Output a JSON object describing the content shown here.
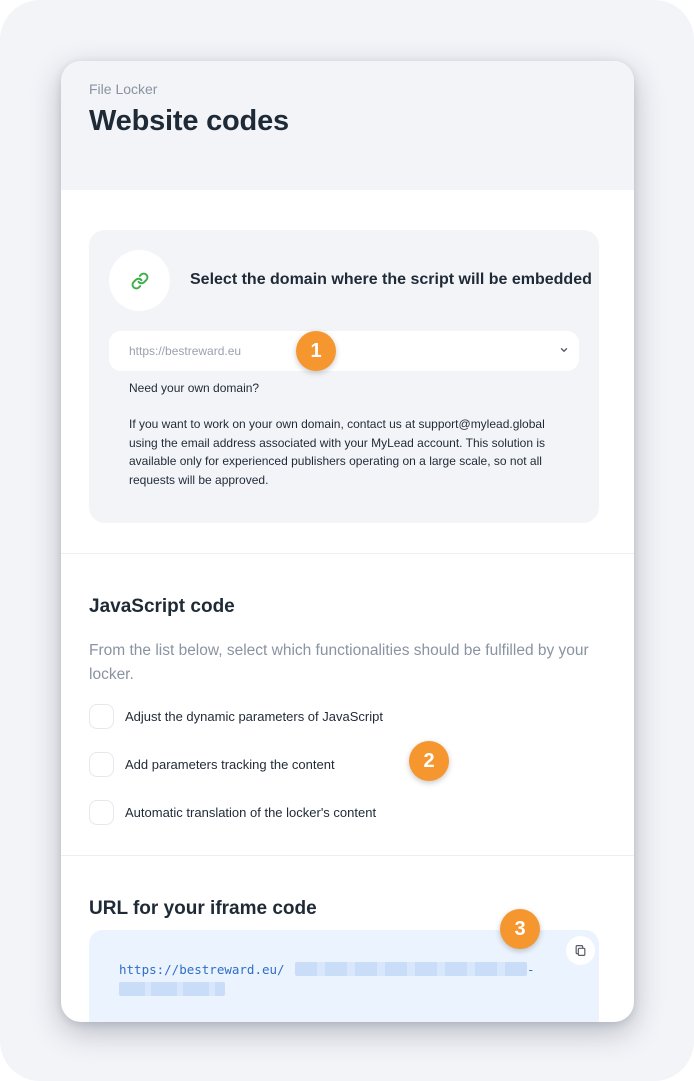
{
  "header": {
    "breadcrumb": "File Locker",
    "title": "Website codes"
  },
  "domain": {
    "icon": "link-icon",
    "heading": "Select the domain where the script will be embedded",
    "selected_value": "https://bestreward.eu",
    "need_own_domain": "Need your own domain?",
    "note": "If you want to work on your own domain, contact us at support@mylead.global using the email address associated with your MyLead account. This solution is available only for experienced publishers operating on a large scale, so not all requests will be approved."
  },
  "javascript": {
    "title": "JavaScript code",
    "description": "From the list below, select which functionalities should be fulfilled by your locker.",
    "options": [
      {
        "label": "Adjust the dynamic parameters of JavaScript",
        "checked": false
      },
      {
        "label": "Add parameters tracking the content",
        "checked": false
      },
      {
        "label": "Automatic translation of the locker's content",
        "checked": false
      }
    ]
  },
  "iframe": {
    "title": "URL for your iframe code",
    "url_prefix": "https://bestreward.eu/",
    "url_suffix": "-",
    "copy_icon": "copy-icon"
  },
  "markers": [
    "1",
    "2",
    "3"
  ],
  "colors": {
    "accent_marker": "#f5962f",
    "link_icon": "#3fae4a",
    "code_text": "#2f6fc8",
    "code_bg": "#eaf3fe"
  }
}
